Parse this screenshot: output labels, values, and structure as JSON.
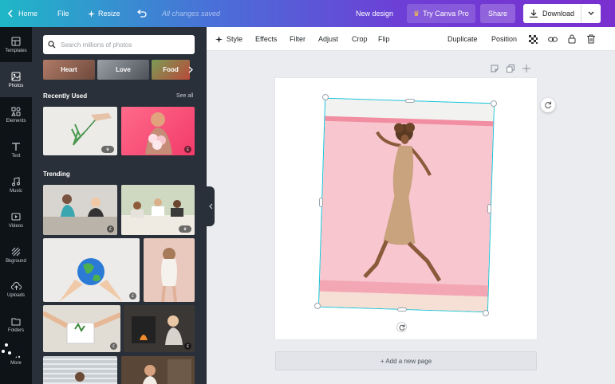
{
  "topbar": {
    "home": "Home",
    "file": "File",
    "resize": "Resize",
    "saved": "All changes saved",
    "new_design": "New design",
    "try_pro": "Try Canva Pro",
    "share": "Share",
    "download": "Download"
  },
  "rail": {
    "items": [
      {
        "label": "Templates"
      },
      {
        "label": "Photos"
      },
      {
        "label": "Elements"
      },
      {
        "label": "Text"
      },
      {
        "label": "Music"
      },
      {
        "label": "Videos"
      },
      {
        "label": "Bkground"
      },
      {
        "label": "Uploads"
      },
      {
        "label": "Folders"
      },
      {
        "label": "More"
      }
    ]
  },
  "panel": {
    "search_placeholder": "Search millions of photos",
    "chips": [
      "Heart",
      "Love",
      "Food"
    ],
    "recently_used": "Recently Used",
    "see_all": "See all",
    "trending": "Trending",
    "badge_free": "£",
    "badge_pro": "♛"
  },
  "edit_bar": {
    "style": "Style",
    "effects": "Effects",
    "filter": "Filter",
    "adjust": "Adjust",
    "crop": "Crop",
    "flip": "Flip",
    "duplicate": "Duplicate",
    "position": "Position"
  },
  "canvas": {
    "add_page": "+ Add a new page"
  },
  "colors": {
    "accent": "#10c5d8",
    "rail_bg": "#0e1318",
    "panel_bg": "#293039"
  }
}
